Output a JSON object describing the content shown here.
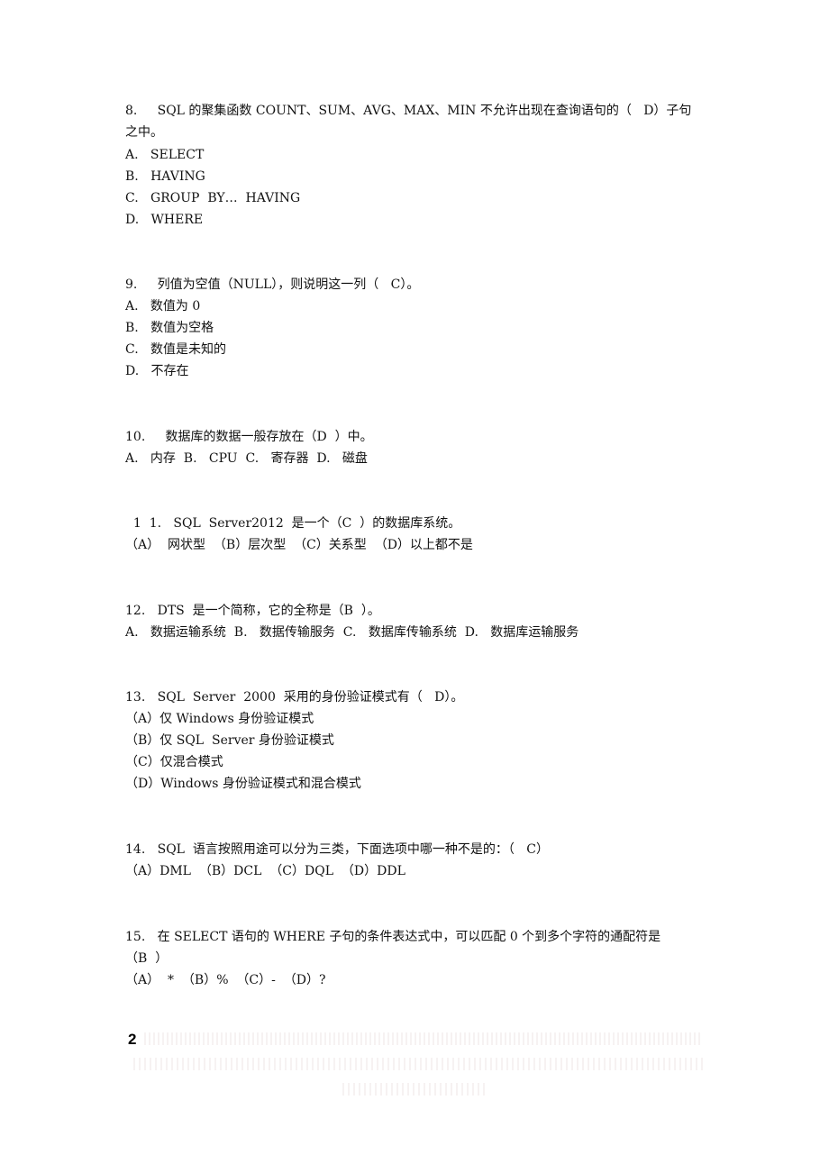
{
  "questions": [
    {
      "stem_line1": "8.     SQL 的聚集函数 COUNT、SUM、AVG、MAX、MIN 不允许出现在查询语句的（   D）子句",
      "stem_line2": "之中。",
      "options": [
        "A.   SELECT",
        "B.   HAVING",
        "C.   GROUP  BY…  HAVING",
        "D.   WHERE"
      ]
    },
    {
      "stem_line1": "9.     列值为空值（NULL），则说明这一列（   C）。",
      "options": [
        "A.   数值为 0",
        "B.   数值为空格",
        "C.   数值是未知的",
        "D.   不存在"
      ]
    },
    {
      "stem_line1": "10.     数据库的数据一般存放在（D  ）中。",
      "options": [
        "A.   内存  B.   CPU  C.   寄存器  D.   磁盘"
      ]
    },
    {
      "stem_line1": "  1  1.   SQL  Server2012  是一个（C  ）的数据库系统。",
      "options": [
        "（A）  网状型  （B）层次型  （C）关系型  （D）以上都不是"
      ]
    },
    {
      "stem_line1": "12.   DTS  是一个简称，它的全称是（B  ）。",
      "options": [
        "A.   数据运输系统  B.   数据传输服务  C.   数据库传输系统  D.   数据库运输服务"
      ]
    },
    {
      "stem_line1": "13.   SQL  Server  2000  采用的身份验证模式有（   D）。",
      "options": [
        "（A）仅 Windows 身份验证模式",
        "（B）仅 SQL  Server 身份验证模式",
        "（C）仅混合模式",
        "（D）Windows 身份验证模式和混合模式"
      ]
    },
    {
      "stem_line1": "14.   SQL  语言按照用途可以分为三类，下面选项中哪一种不是的：（   C）",
      "options": [
        "（A）DML  （B）DCL  （C）DQL  （D）DDL"
      ]
    },
    {
      "stem_line1": "15.   在 SELECT 语句的 WHERE 子句的条件表达式中，可以匹配 0 个到多个字符的通配符是",
      "stem_line2": "（B  ）",
      "options": [
        "（A）  *  （B）%  （C）-  （D）?"
      ]
    }
  ],
  "footer": {
    "page_number": "2"
  }
}
